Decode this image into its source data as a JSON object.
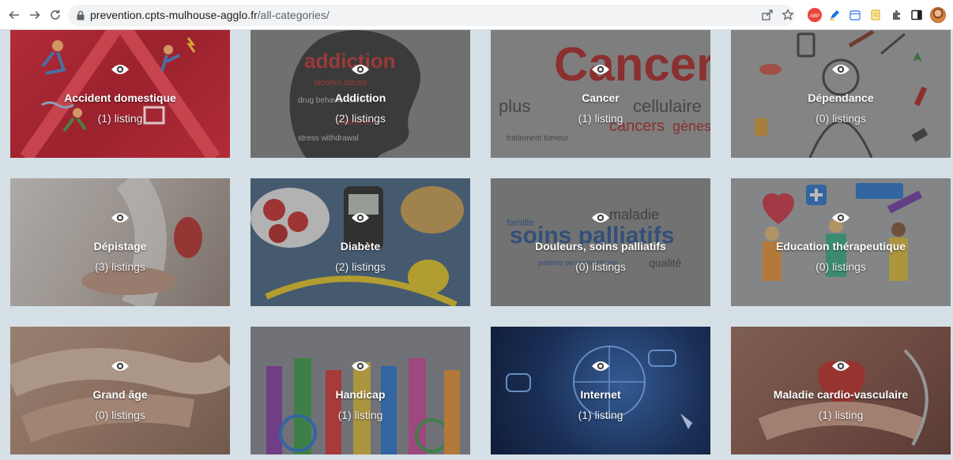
{
  "browser": {
    "url_domain": "prevention.cpts-mulhouse-agglo.fr",
    "url_path": "/all-categories/",
    "icons": [
      "back-icon",
      "forward-icon",
      "reload-icon",
      "lock-icon",
      "share-icon",
      "bookmark-star-icon",
      "adblock-icon",
      "pen-extension-icon",
      "calendar-extension-icon",
      "notes-extension-icon",
      "puzzle-extensions-icon",
      "side-panel-icon",
      "profile-avatar"
    ],
    "colors": {
      "adblock": "#e8453c",
      "pen": "#1a73e8",
      "calendar": "#4a8af4",
      "notes": "#f6bf26"
    }
  },
  "categories": [
    {
      "title": "Accident domestique",
      "count": "(1) listing",
      "color": "#b0303a"
    },
    {
      "title": "Addiction",
      "count": "(2) listings",
      "color": "#8a8a8a"
    },
    {
      "title": "Cancer",
      "count": "(1) listing",
      "color": "#9a9a9a"
    },
    {
      "title": "Dépendance",
      "count": "(0) listings",
      "color": "#a6a6a6"
    },
    {
      "title": "Dépistage",
      "count": "(3) listings",
      "color": "#b8aca4"
    },
    {
      "title": "Diabète",
      "count": "(2) listings",
      "color": "#6b7a8a"
    },
    {
      "title": "Douleurs, soins palliatifs",
      "count": "(0) listings",
      "color": "#8c8c8c"
    },
    {
      "title": "Education thérapeutique",
      "count": "(0) listings",
      "color": "#9aa0a6"
    },
    {
      "title": "Grand âge",
      "count": "(0) listings",
      "color": "#b59a86"
    },
    {
      "title": "Handicap",
      "count": "(1) listing",
      "color": "#7a7f8a"
    },
    {
      "title": "Internet",
      "count": "(1) listing",
      "color": "#233a5e"
    },
    {
      "title": "Maladie cardio-vasculaire",
      "count": "(1) listing",
      "color": "#8a5c52"
    }
  ]
}
